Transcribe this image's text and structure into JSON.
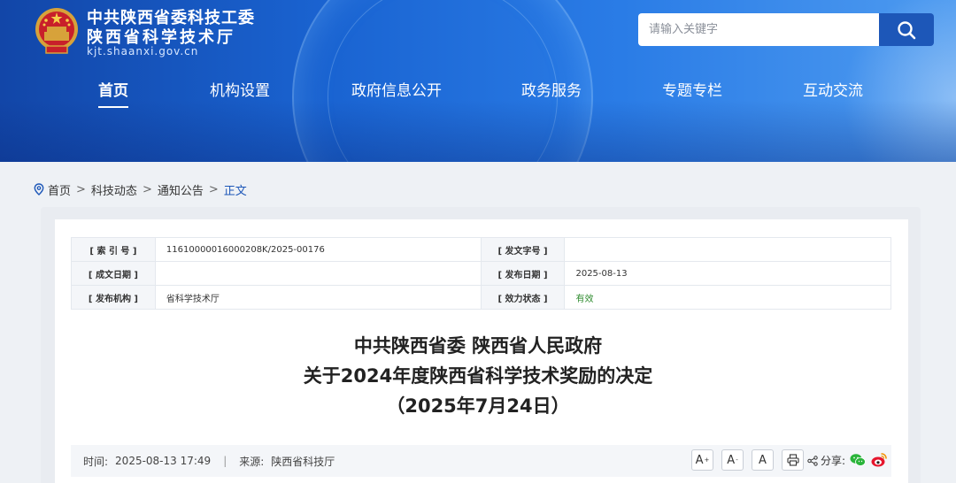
{
  "header": {
    "org_line1": "中共陕西省委科技工委",
    "org_line2": "陕西省科学技术厅",
    "domain": "kjt.shaanxi.gov.cn",
    "search_placeholder": "请输入关键字"
  },
  "nav": {
    "items": [
      {
        "label": "首页",
        "active": true
      },
      {
        "label": "机构设置"
      },
      {
        "label": "政府信息公开"
      },
      {
        "label": "政务服务"
      },
      {
        "label": "专题专栏"
      },
      {
        "label": "互动交流"
      }
    ]
  },
  "breadcrumb": {
    "items": [
      "首页",
      "科技动态",
      "通知公告"
    ],
    "current": "正文",
    "separator": ">"
  },
  "meta": {
    "index_label": "[ 索 引 号 ]",
    "index_value": "11610000016000208K/2025-00176",
    "doc_no_label": "[ 发文字号 ]",
    "doc_no_value": "",
    "created_label": "[ 成文日期 ]",
    "created_value": "",
    "publish_label": "[ 发布日期 ]",
    "publish_value": "2025-08-13",
    "issuer_label": "[ 发布机构 ]",
    "issuer_value": "省科学技术厅",
    "status_label": "[ 效力状态 ]",
    "status_value": "有效"
  },
  "document": {
    "title_line1": "中共陕西省委 陕西省人民政府",
    "title_line2": "关于2024年度陕西省科学技术奖励的决定",
    "title_line3": "（2025年7月24日）"
  },
  "info_bar": {
    "time_label": "时间:",
    "time_value": "2025-08-13 17:49",
    "divider": "|",
    "source_label": "来源:",
    "source_value": "陕西省科技厅",
    "share_label": "分享:",
    "font_buttons": [
      "A",
      "A",
      "A"
    ]
  },
  "colors": {
    "banner_blue": "#1a64d2",
    "accent_blue": "#1d57b8",
    "valid_green": "#2e8b2e"
  }
}
